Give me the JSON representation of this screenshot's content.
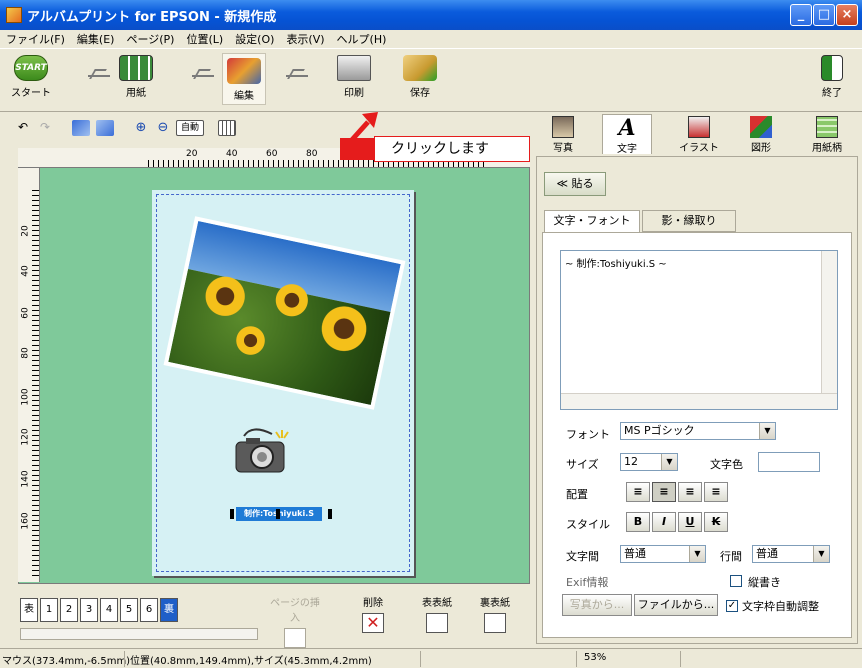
{
  "window": {
    "title": "アルバムプリント for EPSON - 新規作成",
    "controls": [
      "minimize",
      "maximize",
      "close"
    ]
  },
  "menu": [
    "ファイル(F)",
    "編集(E)",
    "ページ(P)",
    "位置(L)",
    "設定(O)",
    "表示(V)",
    "ヘルプ(H)"
  ],
  "main_toolbar": {
    "start": {
      "label": "スタート",
      "badge": "START"
    },
    "paper": "用紙",
    "edit": "編集",
    "print": "印刷",
    "save": "保存",
    "exit": "終了"
  },
  "sub_toolbar": {
    "zoom_auto": "自動"
  },
  "callout": {
    "text": "クリックします"
  },
  "ruler": {
    "h_ticks": [
      "20",
      "40",
      "60",
      "80"
    ],
    "v_ticks": [
      "20",
      "40",
      "60",
      "80",
      "100",
      "120",
      "140",
      "160"
    ]
  },
  "canvas": {
    "selected_text": "制作:Toshiyuki.S"
  },
  "right_tabs": [
    "写真",
    "文字",
    "イラスト",
    "図形",
    "用紙柄"
  ],
  "right_panel": {
    "paste_button": "≪ 貼る",
    "tabs": [
      "文字・フォント",
      "影・縁取り"
    ],
    "text_content": "~ 制作:Toshiyuki.S ~",
    "font_label": "フォント",
    "font_value": "MS Pゴシック",
    "size_label": "サイズ",
    "size_value": "12",
    "color_label": "文字色",
    "align_label": "配置",
    "style_label": "スタイル",
    "style_buttons": [
      "B",
      "I",
      "U",
      "K"
    ],
    "char_spacing_label": "文字間",
    "char_spacing_value": "普通",
    "line_spacing_label": "行間",
    "line_spacing_value": "普通",
    "exif_label": "Exif情報",
    "vertical_label": "縦書き",
    "vertical_checked": false,
    "from_photo_button": "写真から...",
    "from_file_button": "ファイルから...",
    "autofit_label": "文字枠自動調整",
    "autofit_checked": true
  },
  "page_strip": {
    "pages": [
      "表",
      "1",
      "2",
      "3",
      "4",
      "5",
      "6",
      "裏"
    ],
    "insert_page": "ページの挿入",
    "delete": "削除",
    "front_cover": "表表紙",
    "back_cover": "裏表紙"
  },
  "status": {
    "mouse": "マウス(373.4mm,-6.5mm)",
    "position": "位置(40.8mm,149.4mm),サイズ(45.3mm,4.2mm)",
    "zoom": "53%"
  }
}
